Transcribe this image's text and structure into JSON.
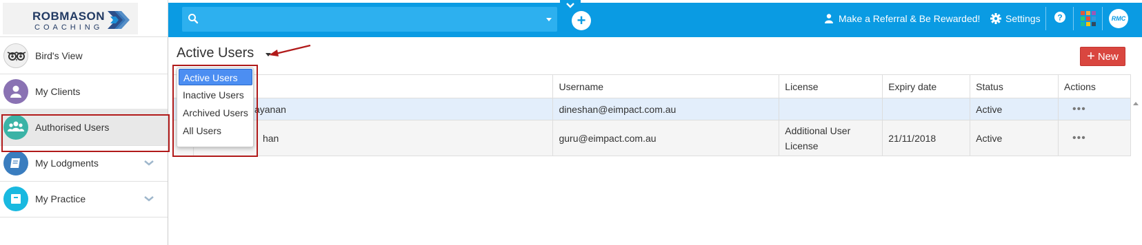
{
  "app": {
    "logo_line1": "ROBMASON",
    "logo_line2": "COACHING"
  },
  "topbar": {
    "search": {
      "value": "",
      "placeholder": ""
    },
    "referral_label": "Make a Referral & Be Rewarded!",
    "settings_label": "Settings",
    "avatar_text": "RMC"
  },
  "sidebar": {
    "items": [
      {
        "label": "Bird's View",
        "icon": "owl-icon",
        "color": "#f0f0f0"
      },
      {
        "label": "My Clients",
        "icon": "user-icon",
        "color": "#8a72b3"
      },
      {
        "label": "Authorised Users",
        "icon": "users-icon",
        "color": "#3bb3a6"
      },
      {
        "label": "My Lodgments",
        "icon": "book-icon",
        "color": "#3a7dbf"
      },
      {
        "label": "My Practice",
        "icon": "archive-icon",
        "color": "#19b9e0"
      }
    ]
  },
  "main": {
    "title": "Active Users",
    "new_button": "New",
    "dropdown": {
      "options": [
        "Active Users",
        "Inactive Users",
        "Archived Users",
        "All Users"
      ],
      "selected": "Active Users"
    },
    "table": {
      "columns": [
        "",
        "",
        "Username",
        "License",
        "Expiry date",
        "Status",
        "Actions"
      ],
      "rows": [
        {
          "name": "Dineshan Narayanan",
          "name_visible": "ayanan",
          "username": "dineshan@eimpact.com.au",
          "license": "",
          "expiry": "",
          "status": "Active",
          "actions": "•••"
        },
        {
          "name": "Guru Shan",
          "name_visible": "han",
          "username": "guru@eimpact.com.au",
          "license": "Additional User License",
          "expiry": "21/11/2018",
          "status": "Active",
          "actions": "•••"
        }
      ]
    }
  },
  "colors": {
    "brand_blue": "#0a9be3",
    "new_button": "#d9463f",
    "highlight_red": "#b11a1a",
    "selected_row": "#e3eefb"
  }
}
